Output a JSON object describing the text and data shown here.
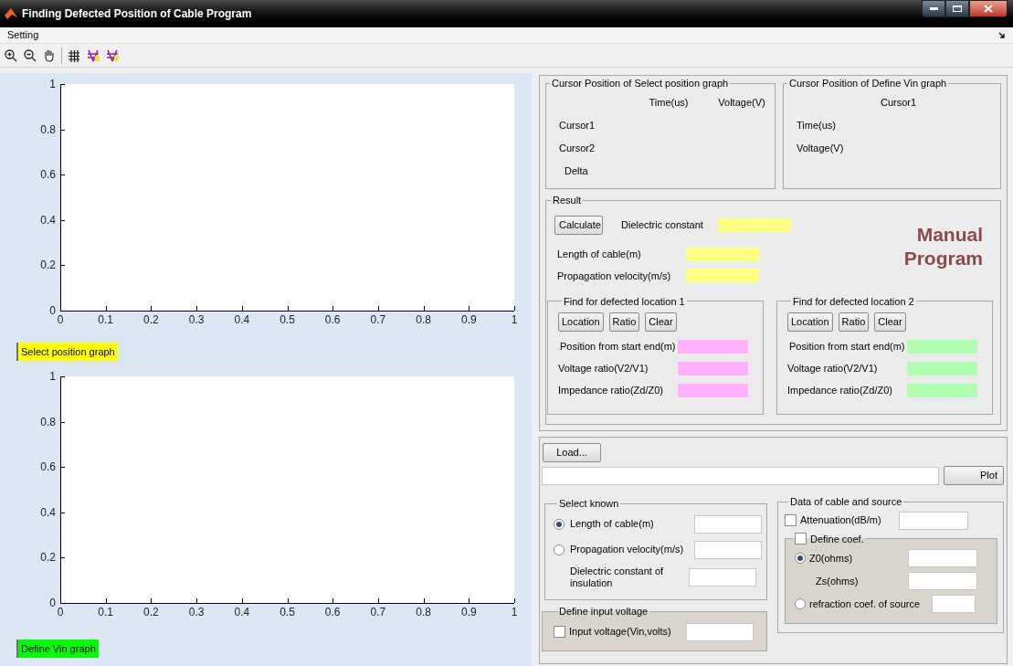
{
  "window": {
    "title": "Finding Defected Position of Cable Program"
  },
  "menu": [
    "Setting"
  ],
  "graphs": [
    {
      "button": "Select position graph",
      "color": "#ffff00",
      "chart_data": {
        "type": "line",
        "xlim": [
          0,
          1
        ],
        "ylim": [
          0,
          1
        ],
        "xticks": [
          0,
          0.1,
          0.2,
          0.3,
          0.4,
          0.5,
          0.6,
          0.7,
          0.8,
          0.9,
          1
        ],
        "yticks": [
          0,
          0.2,
          0.4,
          0.6,
          0.8,
          1
        ]
      }
    },
    {
      "button": "Define Vin graph",
      "color": "#00ff00",
      "chart_data": {
        "type": "line",
        "xlim": [
          0,
          1
        ],
        "ylim": [
          0,
          1
        ],
        "xticks": [
          0,
          0.1,
          0.2,
          0.3,
          0.4,
          0.5,
          0.6,
          0.7,
          0.8,
          0.9,
          1
        ],
        "yticks": [
          0,
          0.2,
          0.4,
          0.6,
          0.8,
          1
        ]
      }
    }
  ],
  "cursor_select": {
    "title": "Cursor Position of Select position graph",
    "columns": [
      "Time(us)",
      "Voltage(V)"
    ],
    "rows": [
      "Cursor1",
      "Cursor2",
      "Delta"
    ]
  },
  "cursor_vin": {
    "title": "Cursor Position of Define Vin graph",
    "column": "Cursor1",
    "rows": [
      "Time(us)",
      "Voltage(V)"
    ]
  },
  "result": {
    "title": "Result",
    "calculate": "Calculate",
    "fields": [
      "Dielectric constant",
      "Length of cable(m)",
      "Propagation velocity(m/s)"
    ],
    "banner": "Manual Program"
  },
  "locations": [
    {
      "title": "Find for defected location 1",
      "buttons": [
        "Location",
        "Ratio",
        "Clear"
      ],
      "fields": [
        "Position from start end(m)",
        "Voltage ratio(V2/V1)",
        "Impedance ratio(Zd/Z0)"
      ],
      "color": "#ffb0ff"
    },
    {
      "title": "Find for defected location 2",
      "buttons": [
        "Location",
        "Ratio",
        "Clear"
      ],
      "fields": [
        "Position from start end(m)",
        "Voltage ratio(V2/V1)",
        "Impedance ratio(Zd/Z0)"
      ],
      "color": "#b0ffb0"
    }
  ],
  "load": {
    "button": "Load...",
    "plot": "Plot"
  },
  "select_known": {
    "title": "Select known",
    "options": [
      {
        "kind": "radio",
        "label": "Length of cable(m)",
        "selected": true
      },
      {
        "kind": "radio",
        "label": "Propagation velocity(m/s)",
        "selected": false
      },
      {
        "kind": "text",
        "label": "Dielectric constant of insulation"
      }
    ]
  },
  "input_voltage": {
    "title": "Define input voltage",
    "label": "Input voltage(Vin,volts)",
    "checked": false
  },
  "cable_source": {
    "title": "Data of cable and source",
    "attenuation": {
      "label": "Attenuation(dB/m)",
      "checked": false
    },
    "define_coef": {
      "label": "Define coef.",
      "checked": false
    },
    "options": [
      {
        "kind": "radio",
        "label": "Z0(ohms)",
        "selected": true
      },
      {
        "kind": "text",
        "label": "Zs(ohms)"
      },
      {
        "kind": "radio",
        "label": "refraction coef. of source",
        "selected": false
      }
    ]
  }
}
